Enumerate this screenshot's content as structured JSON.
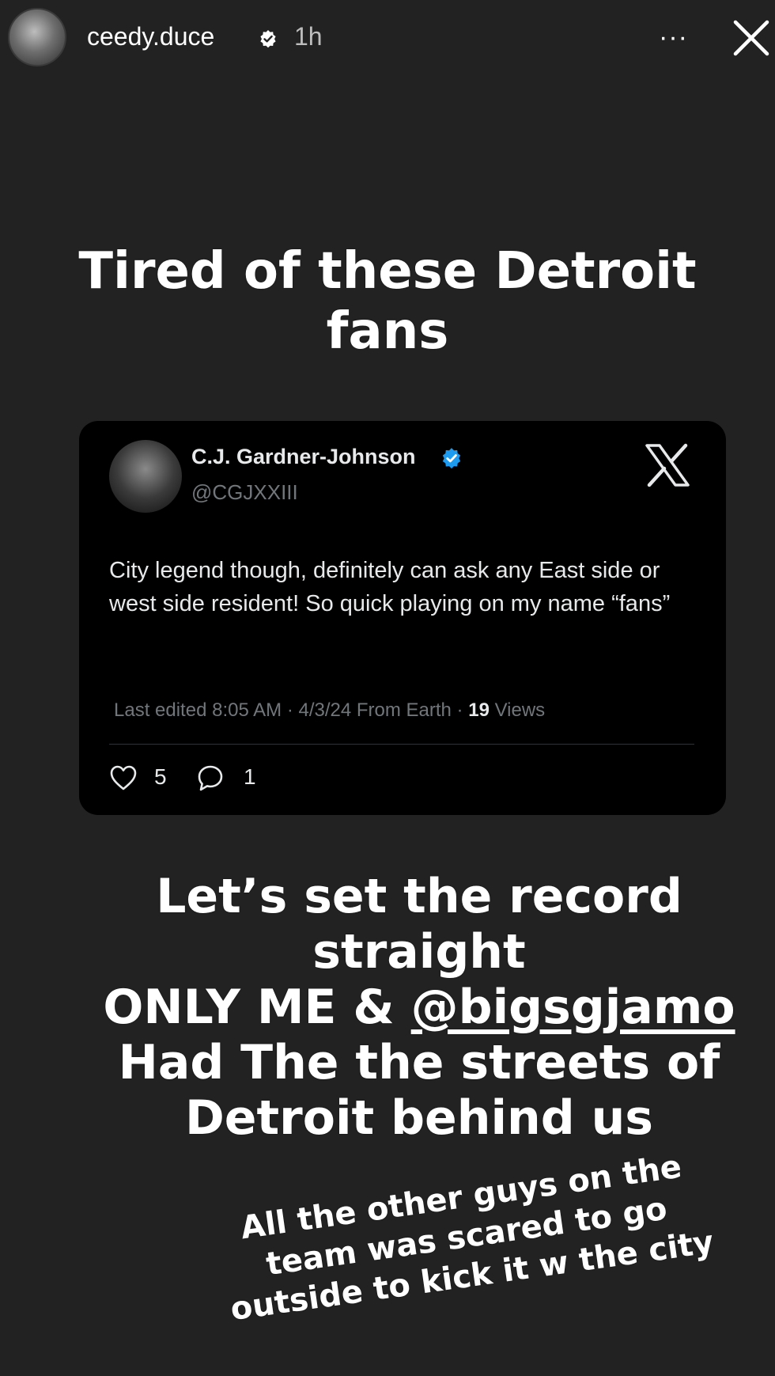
{
  "header": {
    "username": "ceedy.duce",
    "time": "1h",
    "more_label": "···"
  },
  "captions": {
    "top": "Tired of these Detroit fans",
    "middle_line1": "Let’s set the record straight",
    "middle_line2_prefix": "ONLY ME & ",
    "middle_mention": "@bigsgjamo",
    "middle_line3": "Had The the streets of Detroit behind us",
    "bottom": "All the other guys on the team was scared to go outside to kick it w the city"
  },
  "tweet": {
    "name": "C.J. Gardner-Johnson",
    "handle": "@CGJXXIII",
    "text": "City legend though, definitely can ask any East side or west side resident! So quick playing on my name “fans”",
    "meta_prefix": "Last edited 8:05 AM · 4/3/24  From Earth · ",
    "views_count": "19",
    "views_label": " Views",
    "likes": "5",
    "replies": "1"
  },
  "colors": {
    "background": "#222222",
    "card": "#000000",
    "verified": "#1d9bf0",
    "secondary_text": "#71767b"
  },
  "icons": [
    "verified-badge-icon",
    "more-icon",
    "close-icon",
    "x-logo-icon",
    "heart-icon",
    "reply-icon"
  ]
}
